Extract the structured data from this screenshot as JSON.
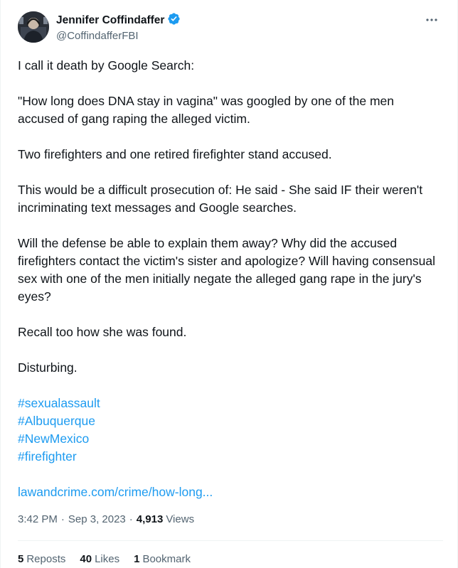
{
  "author": {
    "display_name": "Jennifer Coffindaffer",
    "handle": "@CoffindafferFBI",
    "verified_icon": "verified-badge-icon",
    "verified_color": "#1d9bf0"
  },
  "more_icon": "more-horizontal-icon",
  "tweet": {
    "paragraphs": [
      "I call it death by Google Search:",
      "\"How long does DNA stay in vagina\" was googled by one of the men accused of gang raping the alleged victim.",
      "Two firefighters and one retired firefighter stand accused.",
      "This would be a difficult prosecution of:  He said - She said IF their weren't incriminating text messages and Google searches.",
      "Will the defense be able to explain them away?  Why did the accused firefighters contact the victim's sister and apologize? Will having consensual sex with one of the men initially negate the  alleged gang rape in the jury's eyes?",
      "Recall too how she was found.",
      "Disturbing."
    ],
    "hashtags": [
      "#sexualassault",
      "#Albuquerque",
      "#NewMexico",
      "#firefighter"
    ],
    "link": "lawandcrime.com/crime/how-long...",
    "link_color": "#1d9bf0"
  },
  "meta": {
    "time": "3:42 PM",
    "date": "Sep 3, 2023",
    "views_count": "4,913",
    "views_label": "Views",
    "separator": "·"
  },
  "stats": {
    "reposts_count": "5",
    "reposts_label": "Reposts",
    "likes_count": "40",
    "likes_label": "Likes",
    "bookmarks_count": "1",
    "bookmarks_label": "Bookmark"
  }
}
